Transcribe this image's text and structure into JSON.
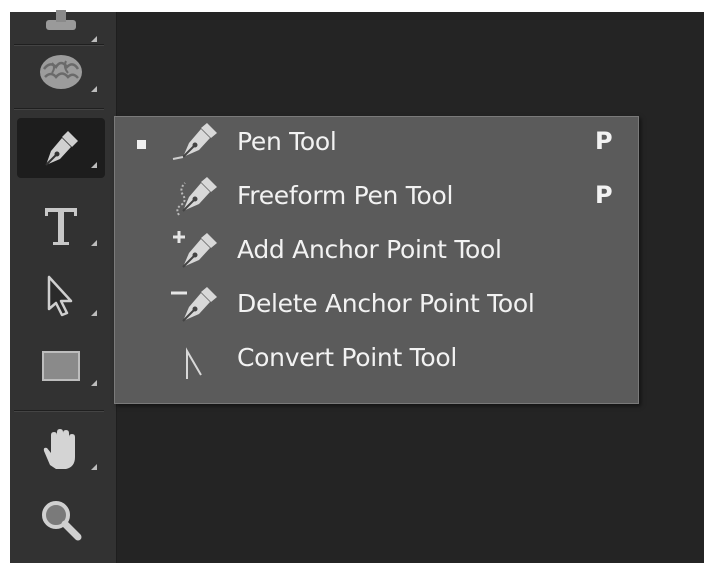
{
  "toolbar": {
    "tools": [
      {
        "name": "stamp-tool-icon"
      },
      {
        "name": "sponge-tool-icon"
      },
      {
        "name": "pen-tool-icon",
        "active": true
      },
      {
        "name": "type-tool-icon",
        "glyph": "T"
      },
      {
        "name": "path-selection-tool-icon"
      },
      {
        "name": "rectangle-tool-icon"
      },
      {
        "name": "hand-tool-icon"
      },
      {
        "name": "zoom-tool-icon"
      }
    ]
  },
  "flyout": {
    "items": [
      {
        "label": "Pen Tool",
        "shortcut": "P",
        "selected": true,
        "icon": "pen-icon"
      },
      {
        "label": "Freeform Pen Tool",
        "shortcut": "P",
        "selected": false,
        "icon": "freeform-pen-icon"
      },
      {
        "label": "Add Anchor Point Tool",
        "shortcut": "",
        "selected": false,
        "icon": "add-anchor-point-icon"
      },
      {
        "label": "Delete Anchor Point Tool",
        "shortcut": "",
        "selected": false,
        "icon": "delete-anchor-point-icon"
      },
      {
        "label": "Convert Point Tool",
        "shortcut": "",
        "selected": false,
        "icon": "convert-point-icon"
      }
    ]
  },
  "colors": {
    "canvas": "#242424",
    "toolbar": "#323232",
    "menu": "#5b5b5b",
    "text": "#f2f2f2"
  }
}
